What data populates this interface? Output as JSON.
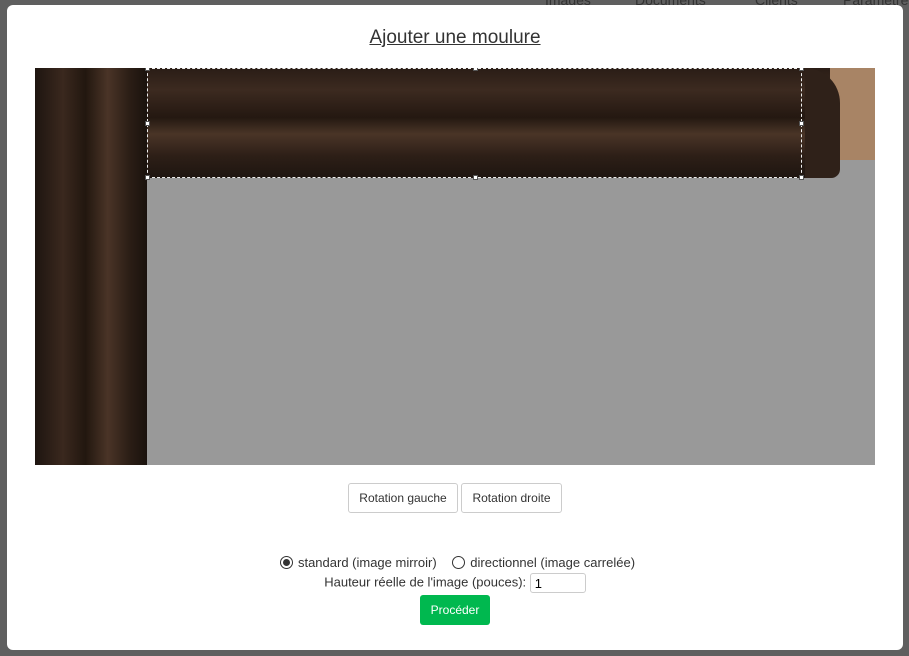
{
  "background_nav": [
    "Images",
    "Documents",
    "Clients",
    "Paramètres"
  ],
  "modal": {
    "title": "Ajouter une moulure",
    "rotate_left": "Rotation gauche",
    "rotate_right": "Rotation droite",
    "option_standard": "standard (image mirroir)",
    "option_directional": "directionnel (image carrelée)",
    "selected_option": "standard",
    "height_label": "Hauteur réelle de l'image (pouces):",
    "height_value": "1",
    "proceed": "Procéder"
  },
  "colors": {
    "proceed": "#00b84f"
  }
}
